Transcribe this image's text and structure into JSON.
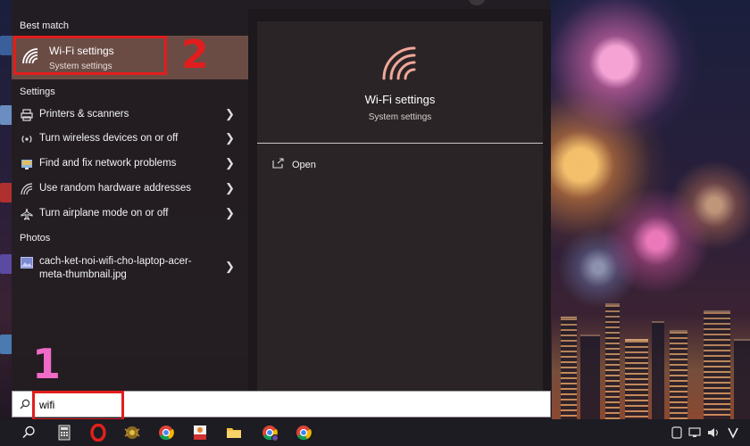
{
  "search_panel": {
    "best_match": {
      "section_label": "Best match",
      "title": "Wi-Fi settings",
      "subtitle": "System settings"
    },
    "settings": {
      "section_label": "Settings",
      "items": [
        {
          "label": "Printers & scanners",
          "icon": "printer-icon"
        },
        {
          "label": "Turn wireless devices on or off",
          "icon": "wireless-icon"
        },
        {
          "label": "Find and fix network problems",
          "icon": "troubleshoot-icon"
        },
        {
          "label": "Use random hardware addresses",
          "icon": "wifi-icon"
        },
        {
          "label": "Turn airplane mode on or off",
          "icon": "airplane-icon"
        }
      ]
    },
    "photos": {
      "section_label": "Photos",
      "items": [
        {
          "label": "cach-ket-noi-wifi-cho-laptop-acer-meta-thumbnail.jpg",
          "icon": "image-icon"
        }
      ]
    },
    "preview": {
      "title": "Wi-Fi settings",
      "subtitle": "System settings",
      "actions": [
        {
          "label": "Open",
          "icon": "open-icon"
        }
      ]
    },
    "search": {
      "value": "wifi"
    }
  },
  "annotations": {
    "step1": "1",
    "step2": "2"
  },
  "colors": {
    "accent": "#f0a898",
    "highlight_row": "#6b4c45",
    "annotation_red": "#e21d1d",
    "annotation_pink": "#f06ac8"
  },
  "taskbar": {
    "apps": [
      "search-icon",
      "calculator-icon",
      "opera-icon",
      "game-icon",
      "chrome-icon",
      "foxit-icon",
      "file-explorer-icon",
      "chrome-profile-icon",
      "chrome-icon"
    ]
  }
}
